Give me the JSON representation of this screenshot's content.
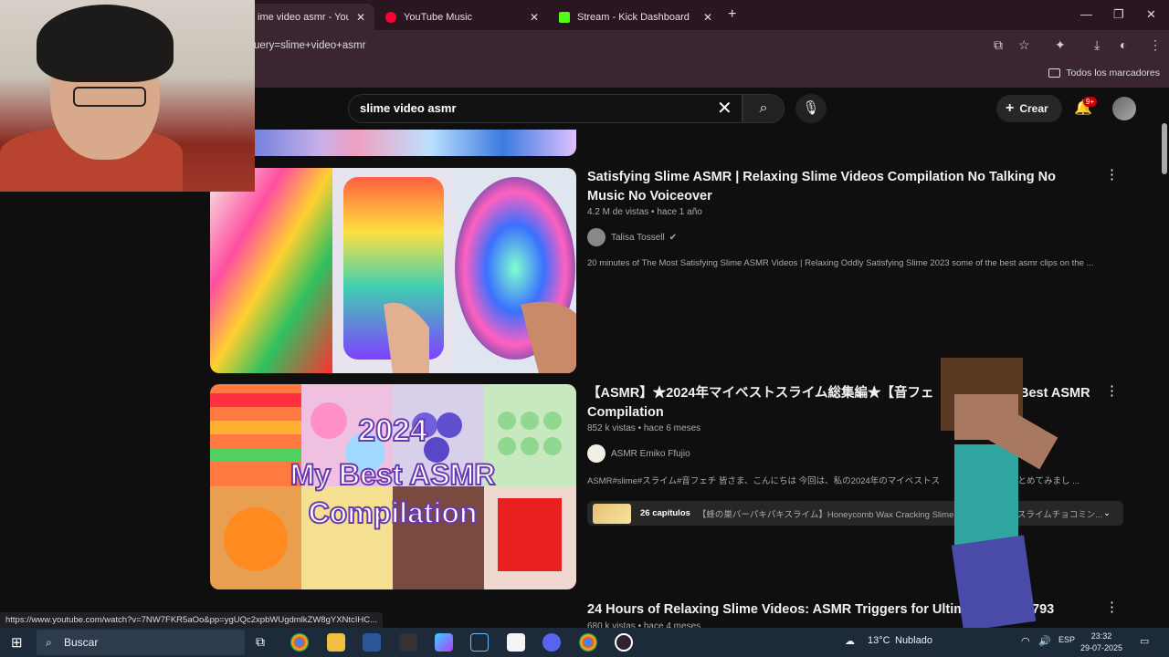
{
  "browser": {
    "tabs": [
      {
        "title": "ime video asmr - YouTub",
        "active": true,
        "favicon_color": "#ff0000"
      },
      {
        "title": "YouTube Music",
        "active": false,
        "favicon_color": "#ff0033"
      },
      {
        "title": "Stream - Kick Dashboard",
        "active": false,
        "favicon_color": "#53fc18"
      }
    ],
    "url": "uery=slime+video+asmr",
    "bookmarks_label": "Todos los marcadores"
  },
  "youtube": {
    "search_value": "slime video asmr",
    "create_label": "Crear",
    "notif_badge": "9+"
  },
  "results": [
    {
      "title": "Satisfying Slime ASMR | Relaxing Slime Videos Compilation No Talking No Music No Voiceover",
      "views": "4.2 M de vistas",
      "age": "hace 1 año",
      "channel": "Talisa Tossell",
      "verified": true,
      "description": "20 minutes of The Most Satisfying Slime ASMR Videos | Relaxing Oddly Satisfying Slime 2023 some of the best asmr clips on the ..."
    },
    {
      "title": "【ASMR】★2024年マイベストスライム総集編★【音フェ",
      "title_end": "Best ASMR",
      "title_line2": "Compilation",
      "views": "852 k vistas",
      "age": "hace 6 meses",
      "channel": "ASMR Emiko Ffujio",
      "description": "ASMR#slime#スライム#音フェチ 皆さま、こんにちは 今回は、私の2024年のマイベストス",
      "description_end": "まとめてみまし ...",
      "chapters_count": "26 capítulos",
      "chapters_text": "【蜂の巣バーパキパキスライム】Honeycomb Wax Cracking Slime",
      "chapters_end": "スライムチョコミン...",
      "thumb_text_year": "2024",
      "thumb_text_line1": "My Best ASMR",
      "thumb_text_line2": "Compilation"
    },
    {
      "title": "24 Hours of Relaxing Slime Videos: ASMR Triggers for Ultimate S",
      "title_end": "793",
      "views": "680 k vistas",
      "age": "hace 4 meses"
    }
  ],
  "status_url": "https://www.youtube.com/watch?v=7NW7FKR5aOo&pp=ygUQc2xpbWUgdmlkZW8gYXNtcIHC...",
  "taskbar": {
    "search_label": "Buscar",
    "weather": "13°C",
    "weather_desc": "Nublado",
    "lang": "ESP",
    "time": "23:32",
    "date": "29-07-2025"
  }
}
